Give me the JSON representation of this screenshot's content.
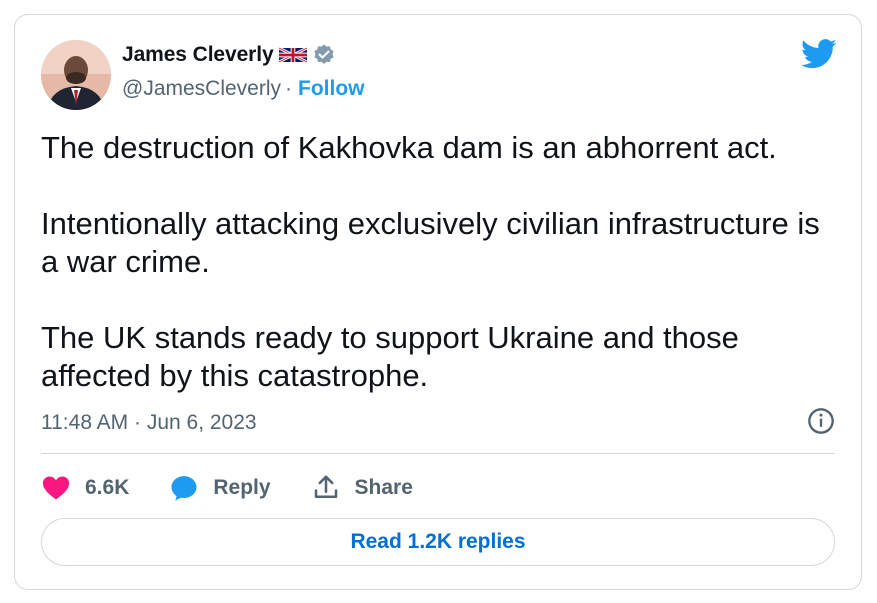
{
  "author": {
    "name": "James Cleverly",
    "handle": "@JamesCleverly",
    "separator": "·",
    "follow_label": "Follow",
    "flag_icon": "uk-flag-icon",
    "verified_icon": "verified-badge-icon",
    "verified_color": "#829aab"
  },
  "tweet": {
    "paragraphs": [
      "The destruction of Kakhovka dam is an abhorrent act.",
      "Intentionally attacking exclusively civilian infrastructure is a war crime.",
      "The UK stands ready to support Ukraine and those affected by this catastrophe."
    ],
    "timestamp": "11:48 AM · Jun 6, 2023"
  },
  "actions": {
    "like_count": "6.6K",
    "reply_label": "Reply",
    "share_label": "Share"
  },
  "read_replies_label": "Read 1.2K replies",
  "colors": {
    "accent": "#1d9bf0",
    "like": "#f91880",
    "secondary_text": "#536471",
    "border": "#cfd9de"
  }
}
